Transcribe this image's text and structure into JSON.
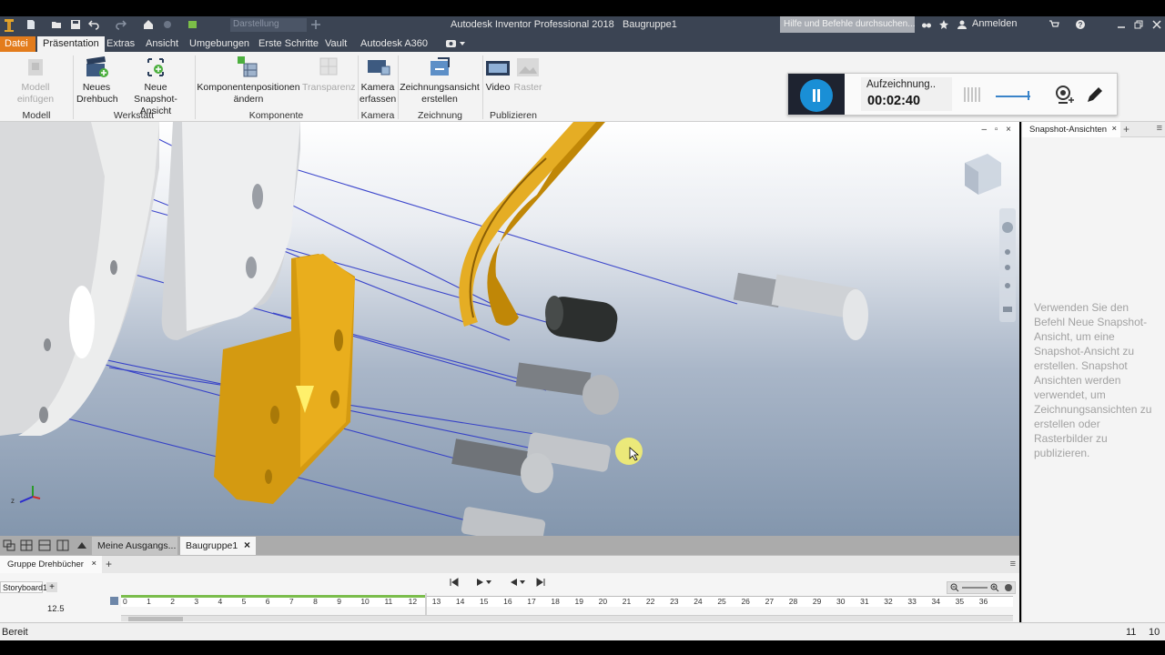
{
  "title_bar": {
    "app_title": "Autodesk Inventor Professional 2018",
    "document_name": "Baugruppe1",
    "style_box_value": "Darstellung",
    "search_placeholder": "Hilfe und Befehle durchsuchen...",
    "signin_label": "Anmelden"
  },
  "menu": {
    "file": "Datei",
    "tabs": [
      "Präsentation",
      "Extras",
      "Ansicht",
      "Umgebungen",
      "Erste Schritte",
      "Vault",
      "Autodesk A360"
    ]
  },
  "ribbon": {
    "buttons": {
      "model_insert": "Modell einfügen",
      "new_storyboard_1": "Neues",
      "new_storyboard_2": "Drehbuch",
      "new_snapshot_1": "Neue",
      "new_snapshot_2": "Snapshot-Ansicht",
      "comp_pos_1": "Komponentenpositionen",
      "comp_pos_2": "ändern",
      "transparency": "Transparenz",
      "camera_1": "Kamera",
      "camera_2": "erfassen",
      "drawing_view_1": "Zeichnungsansicht",
      "drawing_view_2": "erstellen",
      "video": "Video",
      "raster": "Raster"
    },
    "groups": {
      "model": "Modell",
      "workshop": "Werkstatt",
      "component": "Komponente",
      "camera": "Kamera",
      "drawing": "Zeichnung",
      "publish": "Publizieren"
    }
  },
  "recorder": {
    "status": "Aufzeichnung..",
    "time": "00:02:40"
  },
  "snapshot_panel": {
    "tab_label": "Snapshot-Ansichten",
    "hint": "Verwenden Sie den Befehl Neue Snapshot-Ansicht, um eine Snapshot-Ansicht zu erstellen. Snapshot Ansichten werden verwendet, um Zeichnungsansichten zu erstellen oder Rasterbilder zu publizieren."
  },
  "document_tabs": {
    "tab1": "Meine Ausgangs...",
    "tab2": "Baugruppe1"
  },
  "storyboard": {
    "panel_tab": "Gruppe Drehbücher",
    "storyboard_tab": "Storyboard1",
    "current_time": "12.5",
    "ruler_ticks": [
      "0",
      "1",
      "2",
      "3",
      "4",
      "5",
      "6",
      "7",
      "8",
      "9",
      "10",
      "11",
      "12",
      "13",
      "14",
      "15",
      "16",
      "17",
      "18",
      "19",
      "20",
      "21",
      "22",
      "23",
      "24",
      "25",
      "26",
      "27",
      "28",
      "29",
      "30",
      "31",
      "32",
      "33",
      "34",
      "35",
      "36"
    ],
    "green_until_fraction": 0.343
  },
  "status": {
    "text": "Bereit",
    "num1": "11",
    "num2": "10"
  },
  "colors": {
    "accent_orange": "#e37c1c",
    "titlebar": "#3b4453",
    "rec_blue": "#1a8fd6",
    "part_gold": "#e6a512"
  }
}
